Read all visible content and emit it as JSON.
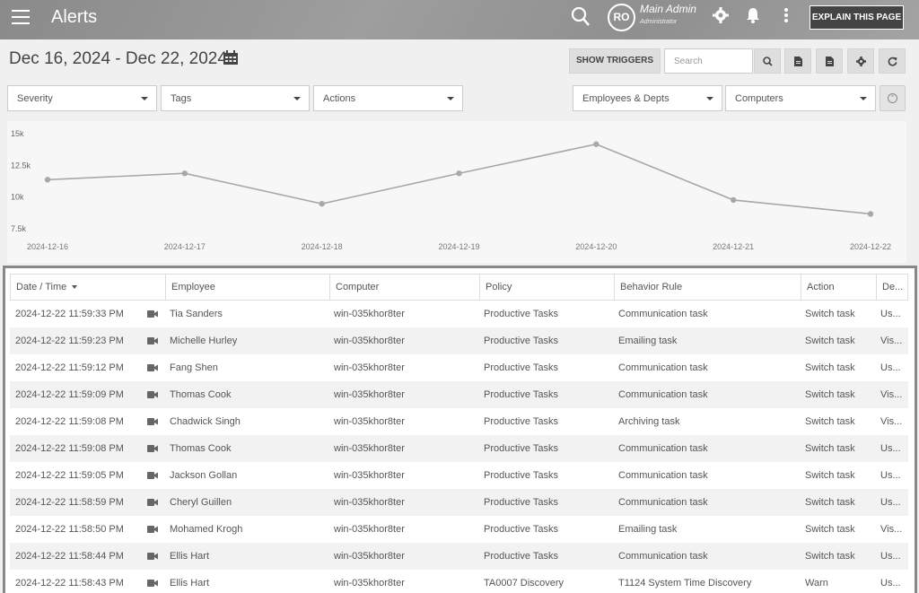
{
  "header": {
    "title": "Alerts",
    "avatar_initials": "RO",
    "user_name": "Main Admin",
    "user_role": "Administrator",
    "explain_label": "EXPLAIN THIS PAGE"
  },
  "toolbar": {
    "date_range": "Dec 16, 2024 - Dec 22, 2024",
    "show_triggers_label": "SHOW TRIGGERS",
    "search_placeholder": "Search"
  },
  "filters": {
    "severity": "Severity",
    "tags": "Tags",
    "actions": "Actions",
    "employees": "Employees & Depts",
    "computers": "Computers"
  },
  "chart_data": {
    "type": "line",
    "x": [
      "2024-12-16",
      "2024-12-17",
      "2024-12-18",
      "2024-12-19",
      "2024-12-20",
      "2024-12-21",
      "2024-12-22"
    ],
    "series": [
      {
        "values": [
          11300,
          11800,
          9400,
          11800,
          14100,
          9700,
          8600
        ]
      }
    ],
    "yticks": [
      "15k",
      "12.5k",
      "10k",
      "7.5k"
    ],
    "ytick_values": [
      15000,
      12500,
      10000,
      7500
    ],
    "ylim": [
      7500,
      15000
    ],
    "color": "#a8a8a8"
  },
  "table": {
    "columns": [
      "Date / Time",
      "Employee",
      "Computer",
      "Policy",
      "Behavior Rule",
      "Action",
      "De..."
    ],
    "rows": [
      [
        "2024-12-22 11:59:33 PM",
        "Tia Sanders",
        "win-035khor8ter",
        "Productive Tasks",
        "Communication task",
        "Switch task",
        "Us..."
      ],
      [
        "2024-12-22 11:59:23 PM",
        "Michelle Hurley",
        "win-035khor8ter",
        "Productive Tasks",
        "Emailing task",
        "Switch task",
        "Vis..."
      ],
      [
        "2024-12-22 11:59:12 PM",
        "Fang Shen",
        "win-035khor8ter",
        "Productive Tasks",
        "Communication task",
        "Switch task",
        "Us..."
      ],
      [
        "2024-12-22 11:59:09 PM",
        "Thomas Cook",
        "win-035khor8ter",
        "Productive Tasks",
        "Communication task",
        "Switch task",
        "Vis..."
      ],
      [
        "2024-12-22 11:59:08 PM",
        "Chadwick Singh",
        "win-035khor8ter",
        "Productive Tasks",
        "Archiving task",
        "Switch task",
        "Vis..."
      ],
      [
        "2024-12-22 11:59:08 PM",
        "Thomas Cook",
        "win-035khor8ter",
        "Productive Tasks",
        "Communication task",
        "Switch task",
        "Us..."
      ],
      [
        "2024-12-22 11:59:05 PM",
        "Jackson Gollan",
        "win-035khor8ter",
        "Productive Tasks",
        "Communication task",
        "Switch task",
        "Us..."
      ],
      [
        "2024-12-22 11:58:59 PM",
        "Cheryl Guillen",
        "win-035khor8ter",
        "Productive Tasks",
        "Communication task",
        "Switch task",
        "Us..."
      ],
      [
        "2024-12-22 11:58:50 PM",
        "Mohamed Krogh",
        "win-035khor8ter",
        "Productive Tasks",
        "Emailing task",
        "Switch task",
        "Vis..."
      ],
      [
        "2024-12-22 11:58:44 PM",
        "Ellis Hart",
        "win-035khor8ter",
        "Productive Tasks",
        "Communication task",
        "Switch task",
        "Us..."
      ],
      [
        "2024-12-22 11:58:43 PM",
        "Ellis Hart",
        "win-035khor8ter",
        "TA0007 Discovery",
        "T1124 System Time Discovery",
        "Warn",
        "Us..."
      ]
    ]
  }
}
